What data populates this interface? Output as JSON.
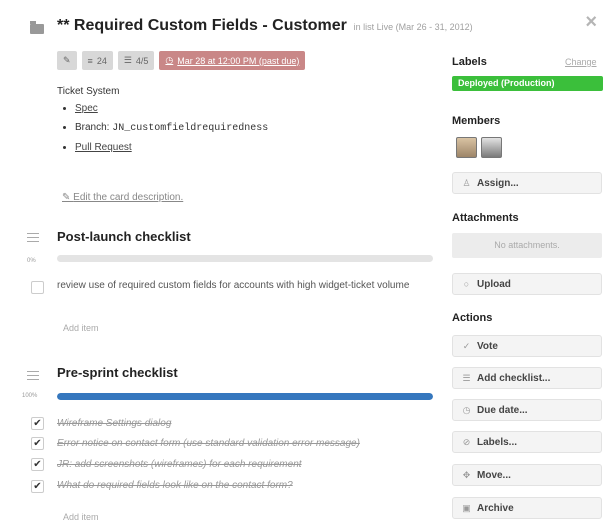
{
  "card": {
    "title": "** Required Custom Fields - Customer",
    "list_info": "in list Live (Mar 26 - 31, 2012)",
    "close_glyph": "×",
    "badges": {
      "comments": "24",
      "checklist": "4/5",
      "due": "Mar 28 at 12:00 PM (past due)"
    },
    "description": {
      "heading": "Ticket System",
      "items": {
        "spec": "Spec",
        "branch_label": "Branch:",
        "branch_value": "JN_customfieldrequiredness",
        "pull_request": "Pull Request"
      },
      "edit_link": "Edit the card description."
    }
  },
  "checklists": [
    {
      "title": "Post-launch checklist",
      "percent_label": "0%",
      "progress": 0,
      "items": [
        {
          "text": "review use of required custom fields for accounts with high widget-ticket volume",
          "done": false
        }
      ],
      "add_item": "Add item"
    },
    {
      "title": "Pre-sprint checklist",
      "percent_label": "100%",
      "progress": 100,
      "items": [
        {
          "text": "Wireframe Settings dialog",
          "done": true
        },
        {
          "text": "Error notice on contact form (use standard validation error message)",
          "done": true
        },
        {
          "text": "JR: add screenshots (wireframes) for each requirement",
          "done": true
        },
        {
          "text": "What do required fields look like on the contact form?",
          "done": true
        }
      ],
      "add_item": "Add item"
    }
  ],
  "sidebar": {
    "labels_heading": "Labels",
    "change_link": "Change",
    "label_text": "Deployed (Production)",
    "label_color": "#3bbf3b",
    "members_heading": "Members",
    "assign_button": "Assign...",
    "attachments_heading": "Attachments",
    "no_attachments": "No attachments.",
    "upload_button": "Upload",
    "actions_heading": "Actions",
    "actions": {
      "vote": "Vote",
      "add_checklist": "Add checklist...",
      "due_date": "Due date...",
      "labels": "Labels...",
      "move": "Move...",
      "archive": "Archive"
    }
  },
  "colors": {
    "progress_fill": "#3577be",
    "due_badge": "#c98787"
  }
}
